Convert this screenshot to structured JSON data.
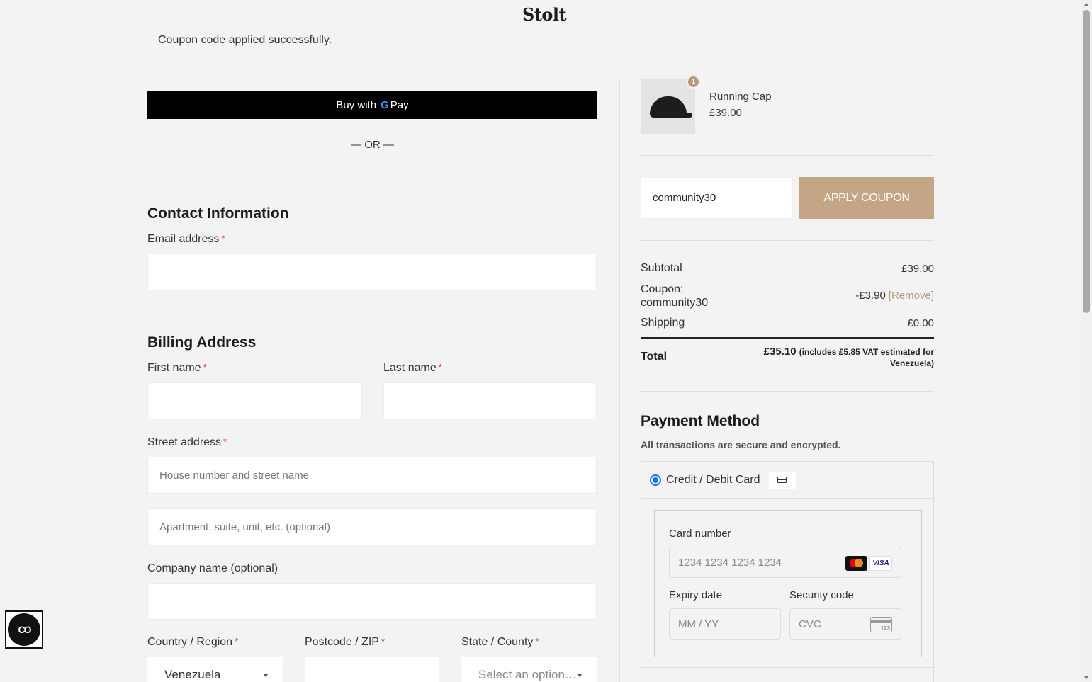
{
  "brand": "Stolt",
  "notice": "Coupon code applied successfully.",
  "express": {
    "gpay_label": "Buy with",
    "gpay_brand": "Pay",
    "or": "— OR —"
  },
  "contact": {
    "heading": "Contact Information",
    "email_label": "Email address",
    "required_mark": "*"
  },
  "billing": {
    "heading": "Billing Address",
    "first_name_label": "First name",
    "last_name_label": "Last name",
    "street_label": "Street address",
    "street_placeholder": "House number and street name",
    "apt_placeholder": "Apartment, suite, unit, etc. (optional)",
    "company_label": "Company name (optional)",
    "country_label": "Country / Region",
    "country_value": "Venezuela",
    "postcode_label": "Postcode / ZIP",
    "state_label": "State / County",
    "state_value": "Select an option…"
  },
  "order": {
    "item": {
      "name": "Running Cap",
      "price": "£39.00",
      "quantity": "1"
    },
    "coupon": {
      "value": "community30",
      "button": "APPLY COUPON"
    },
    "subtotal_label": "Subtotal",
    "subtotal_value": "£39.00",
    "coupon_label": "Coupon: community30",
    "coupon_value": "-£3.90",
    "coupon_remove": "[Remove]",
    "shipping_label": "Shipping",
    "shipping_value": "£0.00",
    "total_label": "Total",
    "total_value": "£35.10",
    "total_note": "(includes £5.85 VAT estimated for Venezuela)"
  },
  "payment": {
    "heading": "Payment Method",
    "subheading": "All transactions are secure and encrypted.",
    "method_label": "Credit / Debit Card",
    "card_number_label": "Card number",
    "card_number_placeholder": "1234 1234 1234 1234",
    "expiry_label": "Expiry date",
    "expiry_placeholder": "MM / YY",
    "cvc_label": "Security code",
    "cvc_placeholder": "CVC",
    "visa": "VISA",
    "cvc_icon_text": "123"
  },
  "a11y_label": "CO",
  "colors": {
    "accent": "#c4a586",
    "gpay_bg": "#000000",
    "radio": "#1a73e8"
  }
}
